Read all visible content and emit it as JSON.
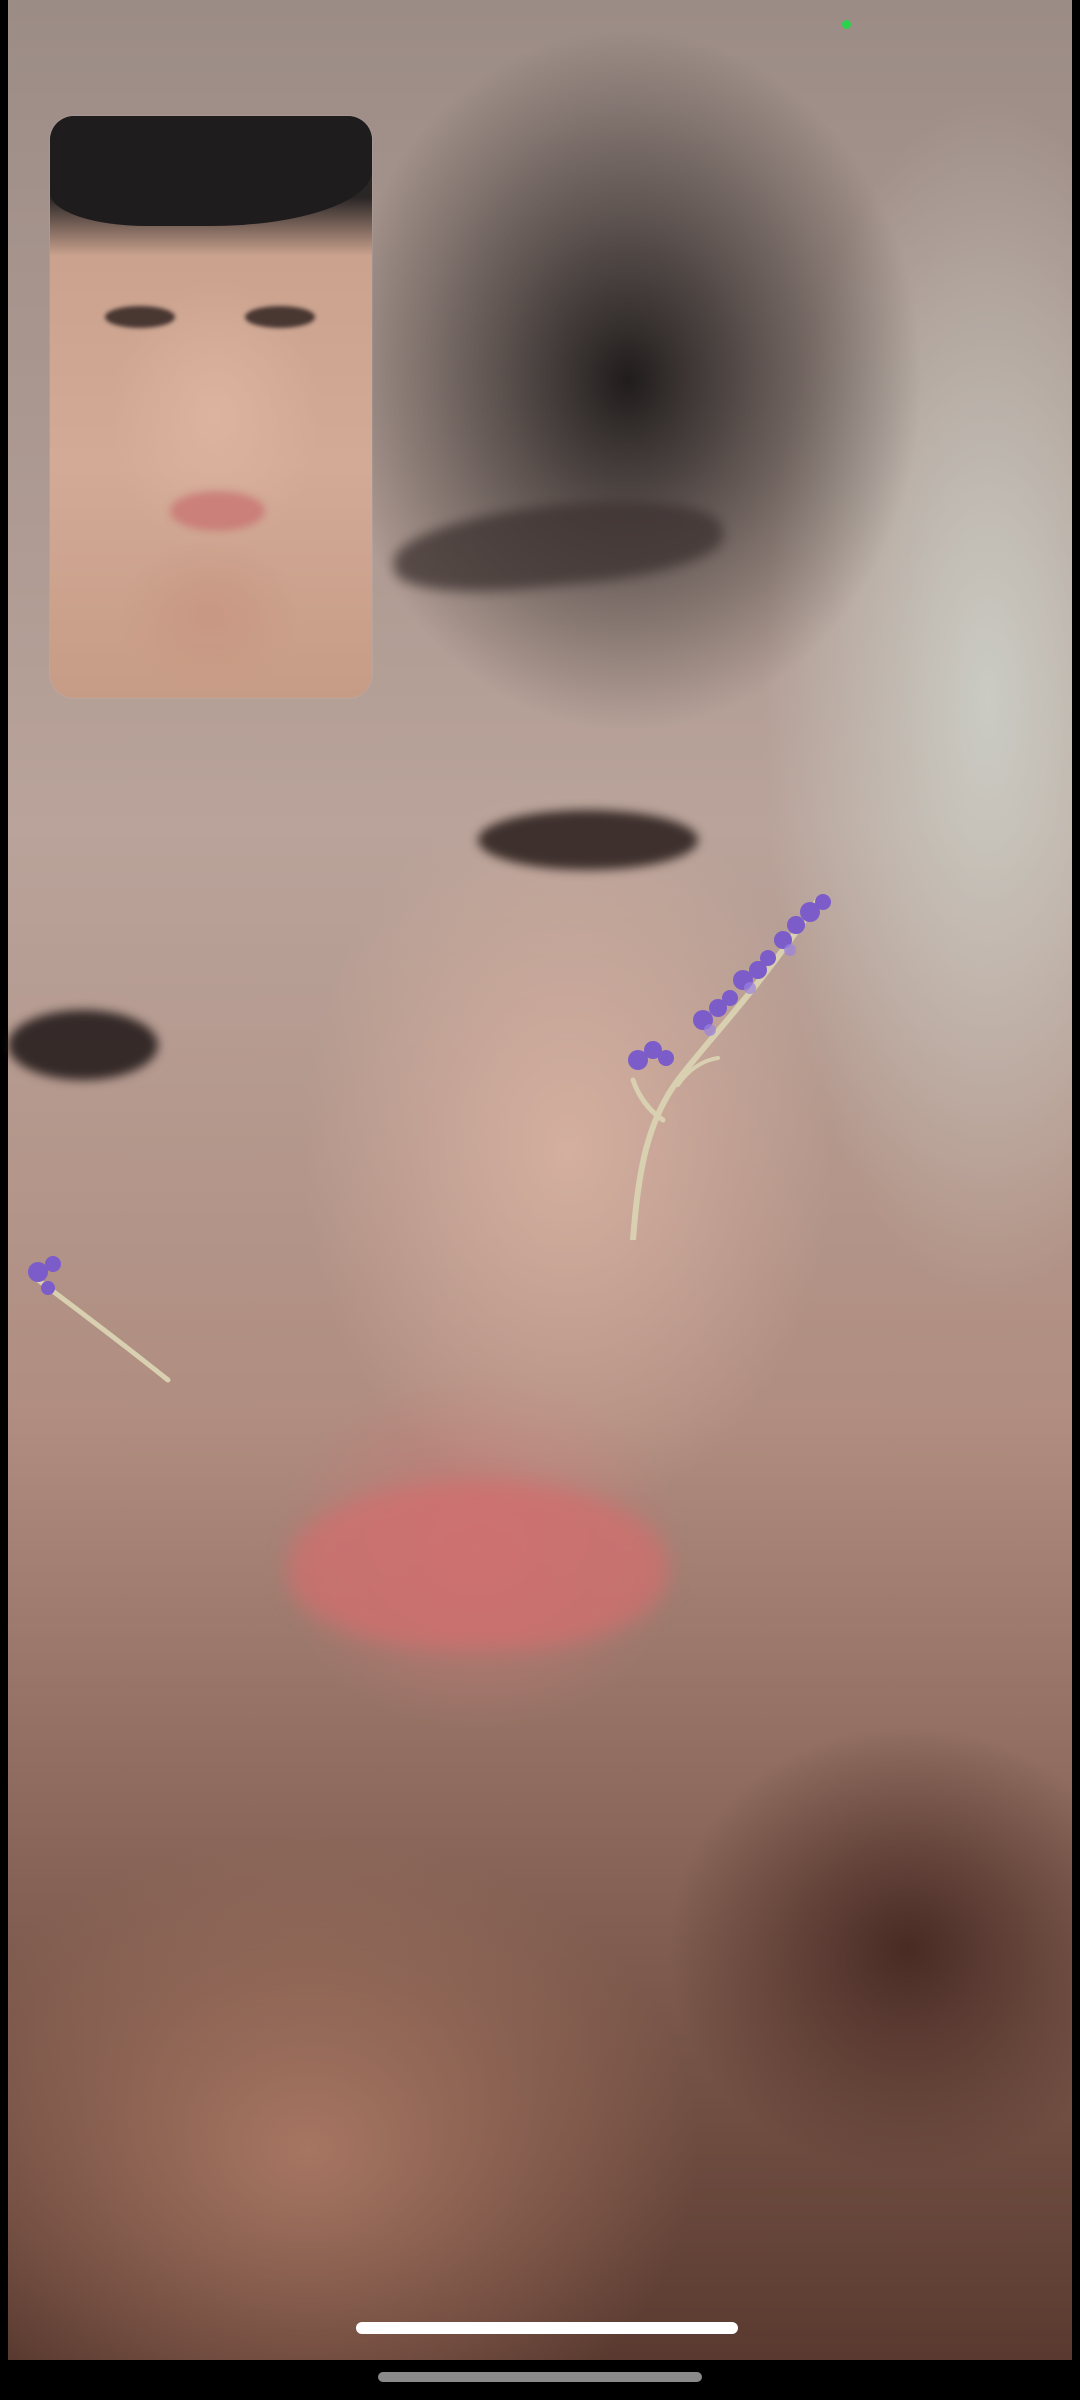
{
  "app": {
    "screen": "video-call"
  },
  "remote_video": {
    "filter": "lavender-flower-sticker"
  },
  "self_view": {
    "visible": true
  },
  "status": {
    "camera_in_use_indicator": true
  },
  "colors": {
    "camera_indicator": "#2bd24b",
    "home_indicator": "#ffffff",
    "sticker_flower": "#7b5cc9",
    "sticker_stem": "#d8d0b0"
  },
  "icons": {
    "sticker": "lavender-sprig"
  }
}
